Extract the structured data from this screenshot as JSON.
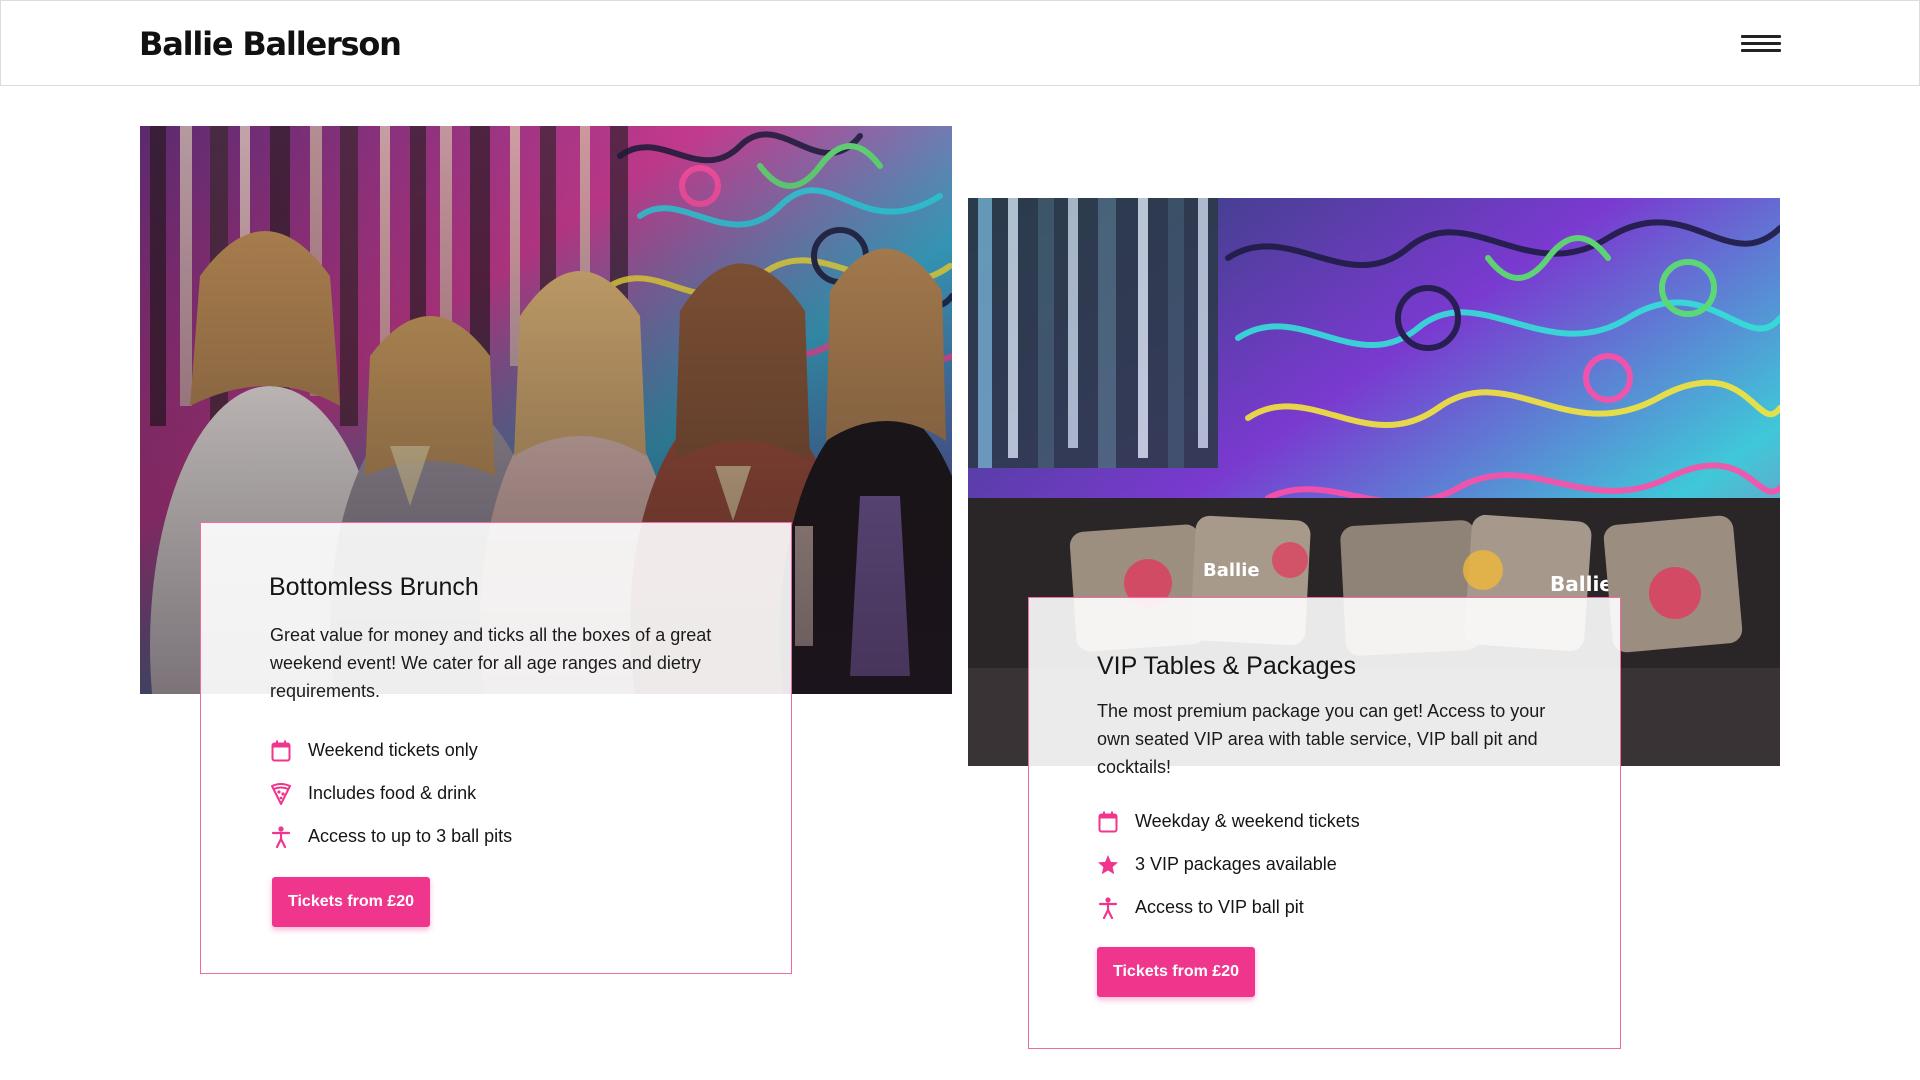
{
  "site": {
    "logo": "Ballie Ballerson",
    "menu_icon": "hamburger-icon"
  },
  "colors": {
    "accent": "#f0358c",
    "card_border": "#f06aa6",
    "text": "#151515"
  },
  "cards": [
    {
      "title": "Bottomless Brunch",
      "description": "Great value for money and ticks all the boxes of a great weekend event! We cater for all age ranges and dietry requirements.",
      "features": [
        {
          "icon": "calendar-icon",
          "label": "Weekend tickets only"
        },
        {
          "icon": "pizza-icon",
          "label": "Includes food & drink"
        },
        {
          "icon": "person-icon",
          "label": "Access to up to 3 ball pits"
        }
      ],
      "button_label": "Tickets from £20"
    },
    {
      "title": "VIP Tables & Packages",
      "description": "The most premium package you can get! Access to your own seated VIP area with table service, VIP ball pit and cocktails!",
      "features": [
        {
          "icon": "calendar-icon",
          "label": "Weekday & weekend tickets"
        },
        {
          "icon": "star-icon",
          "label": "3 VIP packages available"
        },
        {
          "icon": "person-icon",
          "label": "Access to VIP ball pit"
        }
      ],
      "button_label": "Tickets from £20"
    }
  ],
  "photo_text": {
    "cushion_1": "Ballie",
    "cushion_2": "Ballie"
  }
}
